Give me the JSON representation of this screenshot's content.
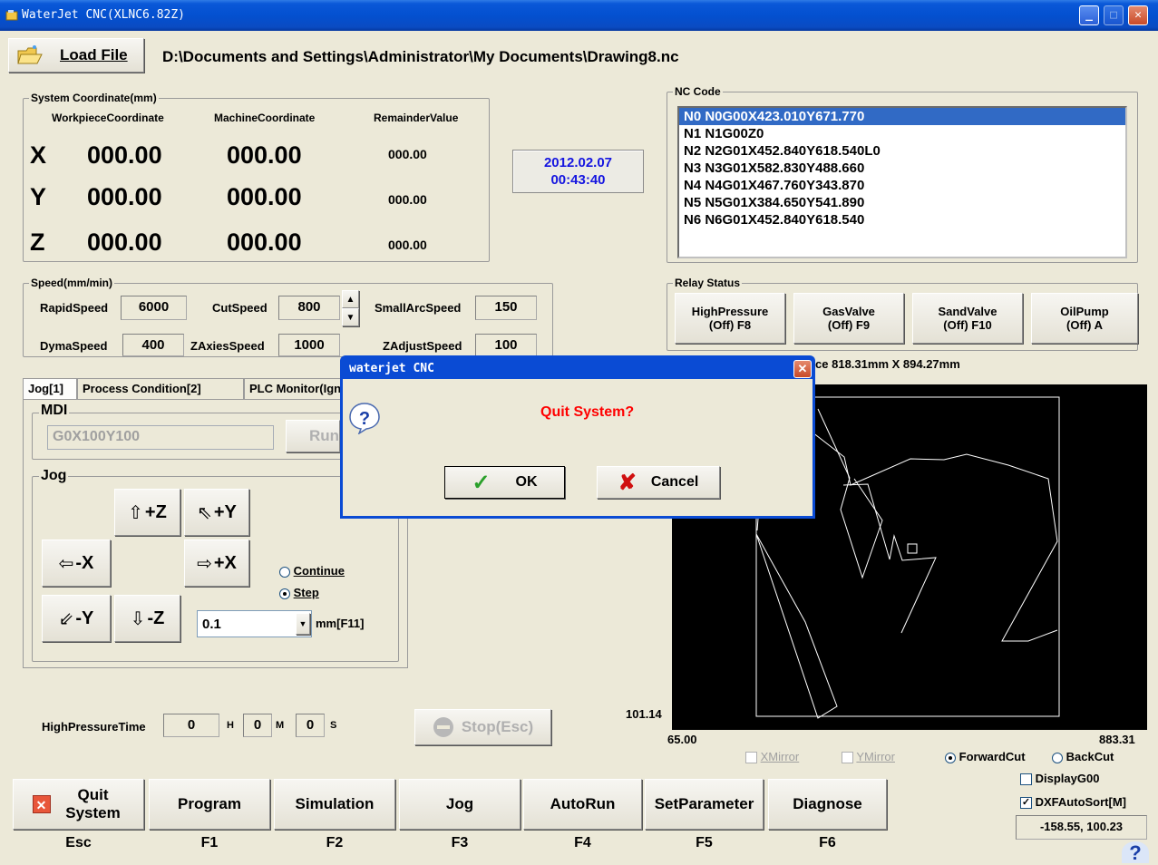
{
  "window": {
    "title": "WaterJet CNC(XLNC6.82Z)"
  },
  "load": {
    "button_label": "Load File",
    "path": "D:\\Documents and Settings\\Administrator\\My Documents\\Drawing8.nc"
  },
  "coords": {
    "group_title": "System Coordinate(mm)",
    "headers": [
      "WorkpieceCoordinate",
      "MachineCoordinate",
      "RemainderValue"
    ],
    "rows": [
      {
        "axis": "X",
        "workpiece": "000.00",
        "machine": "000.00",
        "remainder": "000.00"
      },
      {
        "axis": "Y",
        "workpiece": "000.00",
        "machine": "000.00",
        "remainder": "000.00"
      },
      {
        "axis": "Z",
        "workpiece": "000.00",
        "machine": "000.00",
        "remainder": "000.00"
      }
    ]
  },
  "datetime": {
    "date": "2012.02.07",
    "time": "00:43:40"
  },
  "nc": {
    "group_title": "NC Code",
    "lines": [
      "N0 N0G00X423.010Y671.770",
      "N1 N1G00Z0",
      "N2 N2G01X452.840Y618.540L0",
      "N3 N3G01X582.830Y488.660",
      "N4 N4G01X467.760Y343.870",
      "N5 N5G01X384.650Y541.890",
      "N6 N6G01X452.840Y618.540"
    ],
    "selected_index": 0
  },
  "speed": {
    "group_title": "Speed(mm/min)",
    "rapid_label": "RapidSpeed",
    "rapid": "6000",
    "cut_label": "CutSpeed",
    "cut": "800",
    "smallarc_label": "SmallArcSpeed",
    "smallarc": "150",
    "dyma_label": "DymaSpeed",
    "dyma": "400",
    "zaxies_label": "ZAxiesSpeed",
    "zaxies": "1000",
    "zadjust_label": "ZAdjustSpeed",
    "zadjust": "100"
  },
  "relay": {
    "group_title": "Relay Status",
    "buttons": [
      {
        "line1": "HighPressure",
        "line2": "(Off) F8"
      },
      {
        "line1": "GasValve",
        "line2": "(Off) F9"
      },
      {
        "line1": "SandValve",
        "line2": "(Off) F10"
      },
      {
        "line1": "OilPump",
        "line2": "(Off) A"
      }
    ]
  },
  "workpiece_size": "Workpiece 818.31mm X 894.27mm",
  "tabs": [
    "Jog[1]",
    "Process Condition[2]",
    "PLC Monitor(Ignore)"
  ],
  "mdi": {
    "group_title": "MDI",
    "value": "G0X100Y100",
    "run_label": "Run"
  },
  "jog": {
    "group_title": "Jog",
    "plus_z": "+Z",
    "plus_y": "+Y",
    "minus_x": "-X",
    "plus_x": "+X",
    "minus_y": "-Y",
    "minus_z": "-Z",
    "continue_label": "Continue",
    "step_label": "Step",
    "mode": "Step",
    "step_value": "0.1",
    "step_unit": "mm[F11]"
  },
  "hp_time": {
    "label": "HighPressureTime",
    "h": "0",
    "h_unit": "H",
    "m": "0",
    "m_unit": "M",
    "s": "0",
    "s_unit": "S"
  },
  "stop": {
    "label": "Stop(Esc)"
  },
  "canvas": {
    "y_max": "101.14",
    "x_min": "65.00",
    "x_max": "883.31",
    "x_mirror": "XMirror",
    "y_mirror": "YMirror",
    "forward_cut": "ForwardCut",
    "back_cut": "BackCut",
    "cut_direction": "ForwardCut",
    "display_g00": "DisplayG00",
    "display_g00_checked": false,
    "dxf_auto_sort": "DXFAutoSort[M]",
    "dxf_auto_sort_checked": true,
    "cursor_coord": "-158.55, 100.23"
  },
  "footer": {
    "buttons": [
      {
        "label": "Quit System",
        "key": "Esc"
      },
      {
        "label": "Program",
        "key": "F1"
      },
      {
        "label": "Simulation",
        "key": "F2"
      },
      {
        "label": "Jog",
        "key": "F3"
      },
      {
        "label": "AutoRun",
        "key": "F4"
      },
      {
        "label": "SetParameter",
        "key": "F5"
      },
      {
        "label": "Diagnose",
        "key": "F6"
      }
    ]
  },
  "dialog": {
    "title": "waterjet CNC",
    "message": "Quit System?",
    "ok": "OK",
    "cancel": "Cancel"
  },
  "colors": {
    "selection": "#316ac5",
    "date_text": "#1515e0",
    "dialog_message": "#ff0000",
    "titlebar": "#0350d0"
  }
}
